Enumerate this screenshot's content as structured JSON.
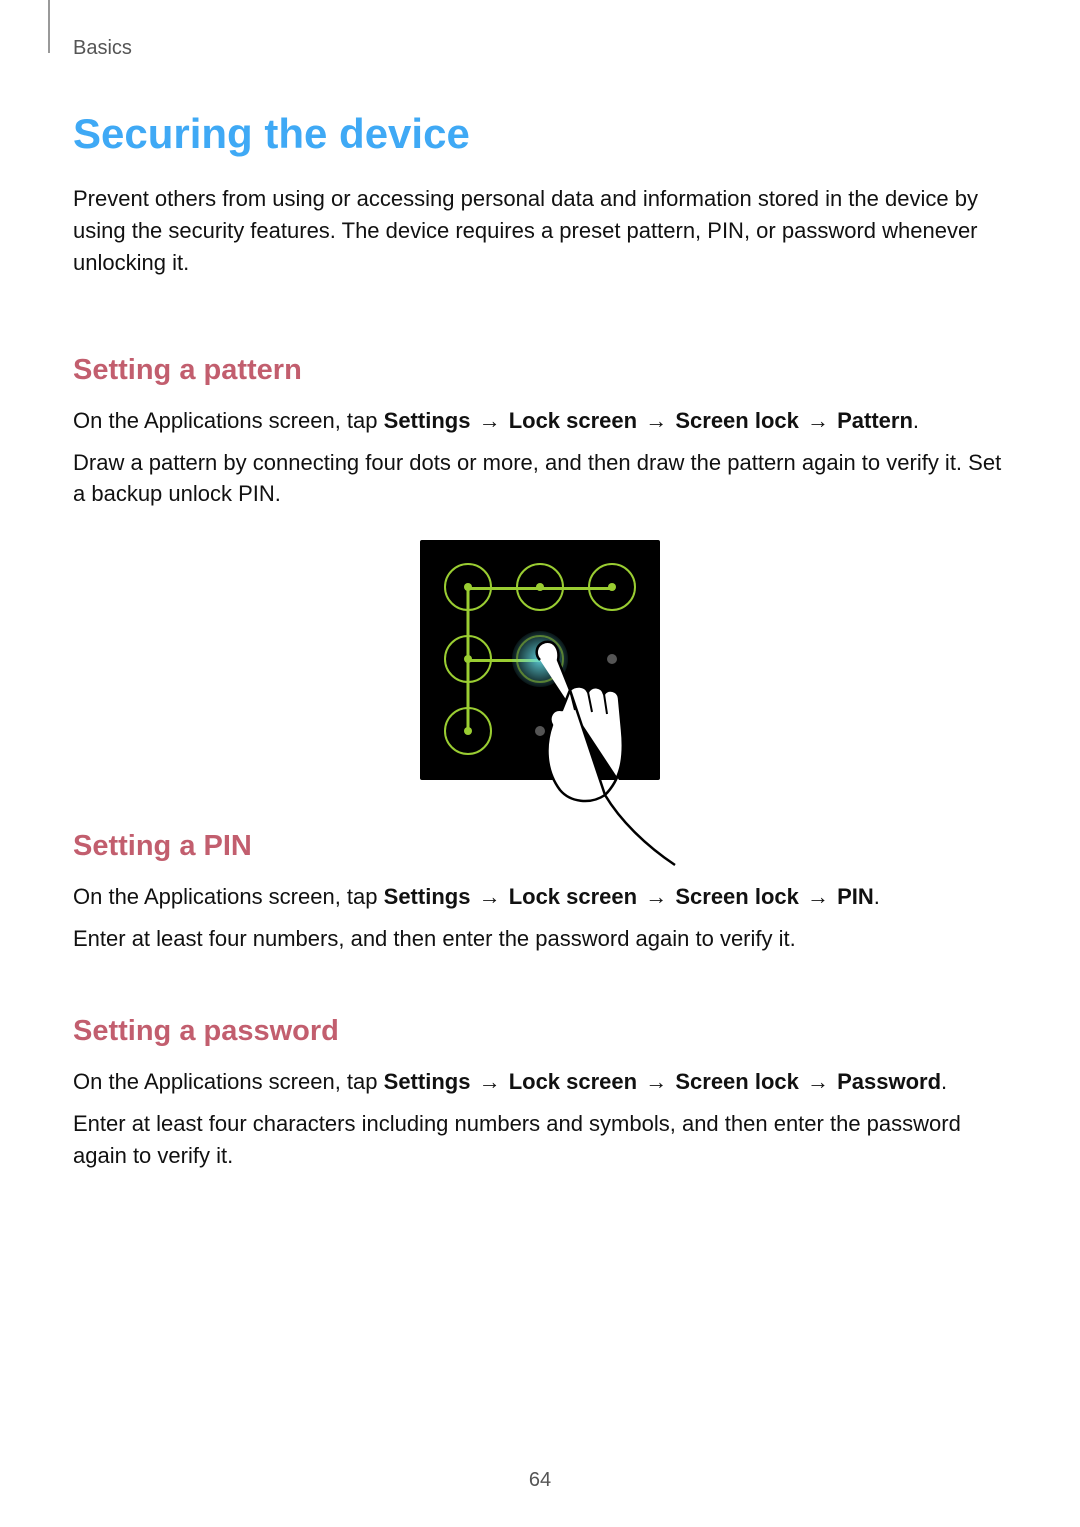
{
  "breadcrumb": "Basics",
  "title": "Securing the device",
  "intro": "Prevent others from using or accessing personal data and information stored in the device by using the security features. The device requires a preset pattern, PIN, or password whenever unlocking it.",
  "sections": {
    "pattern": {
      "heading": "Setting a pattern",
      "nav_prefix": "On the Applications screen, tap ",
      "nav_settings": "Settings",
      "nav_lockscreen": "Lock screen",
      "nav_screenlock": "Screen lock",
      "nav_pattern": "Pattern",
      "nav_period": ".",
      "body": "Draw a pattern by connecting four dots or more, and then draw the pattern again to verify it. Set a backup unlock PIN."
    },
    "pin": {
      "heading": "Setting a PIN",
      "nav_prefix": "On the Applications screen, tap ",
      "nav_settings": "Settings",
      "nav_lockscreen": "Lock screen",
      "nav_screenlock": "Screen lock",
      "nav_pin": "PIN",
      "nav_period": ".",
      "body": "Enter at least four numbers, and then enter the password again to verify it."
    },
    "password": {
      "heading": "Setting a password",
      "nav_prefix": "On the Applications screen, tap ",
      "nav_settings": "Settings",
      "nav_lockscreen": "Lock screen",
      "nav_screenlock": "Screen lock",
      "nav_password": "Password",
      "nav_period": ".",
      "body": "Enter at least four characters including numbers and symbols, and then enter the password again to verify it."
    }
  },
  "arrow_symbol": "→",
  "page_number": "64"
}
